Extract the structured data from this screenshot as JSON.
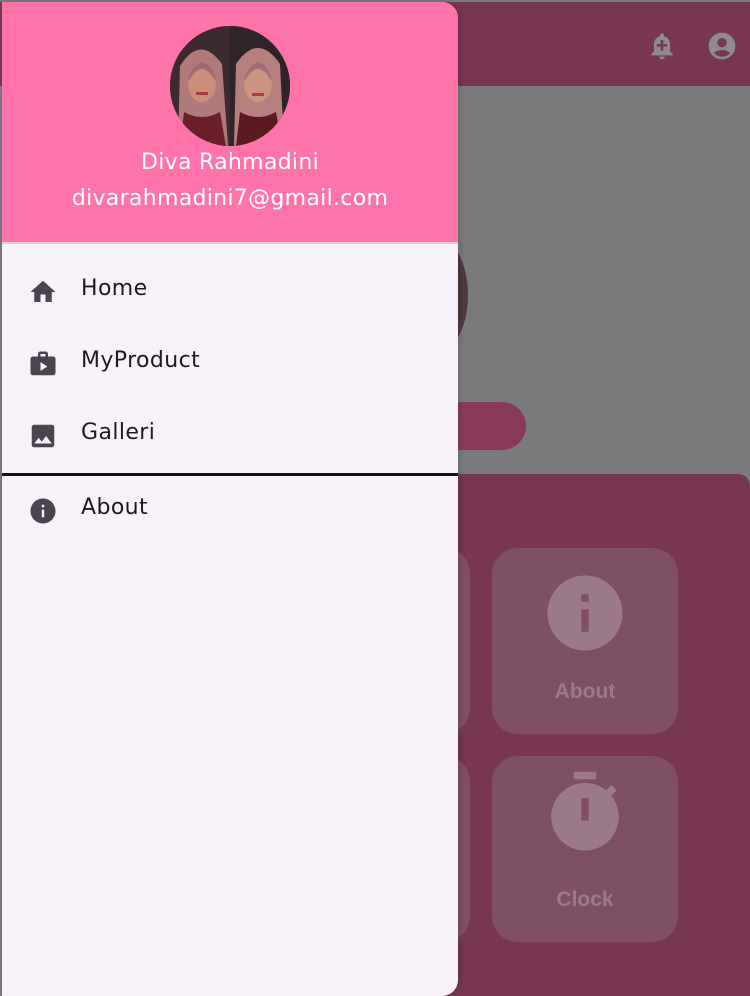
{
  "drawer": {
    "user_name": "Diva Rahmadini",
    "user_email": "divarahmadini7@gmail.com",
    "menu": [
      {
        "label": "Home",
        "icon": "home-icon"
      },
      {
        "label": "MyProduct",
        "icon": "product-icon"
      },
      {
        "label": "Galleri",
        "icon": "image-icon"
      },
      {
        "label": "About",
        "icon": "info-icon"
      }
    ]
  },
  "background": {
    "tiles": [
      {
        "label": "About",
        "icon": "info-icon"
      },
      {
        "label": "Clock",
        "icon": "stopwatch-icon"
      }
    ],
    "appbar_actions": [
      "add-alert-icon",
      "account-icon"
    ]
  },
  "colors": {
    "drawer_header": "#ff73ab",
    "drawer_bg": "#f7f2f9",
    "appbar": "#773753",
    "icon": "#49454f"
  }
}
